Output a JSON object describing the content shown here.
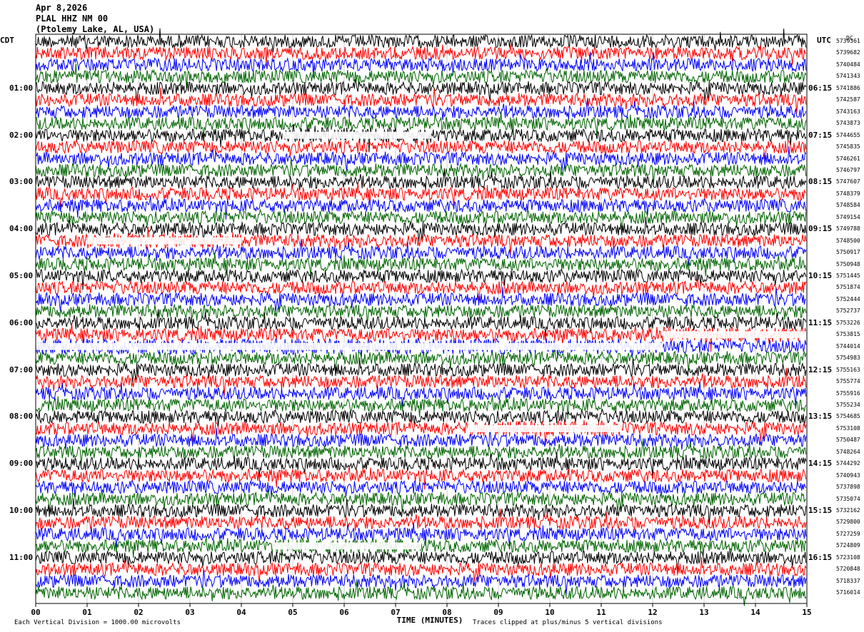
{
  "header": {
    "date": "Apr 8,2026",
    "station": "PLAL HHZ NM 00",
    "location": "(Ptolemy Lake, AL, USA)"
  },
  "left_tz": "CDT",
  "right_tz": "UTC",
  "dc_label": "DC",
  "chart_data": {
    "type": "line",
    "title": "",
    "xlabel": "TIME (MINUTES)",
    "ylabel": "",
    "xlim": [
      0,
      15
    ],
    "x_ticks": [
      "00",
      "01",
      "02",
      "03",
      "04",
      "05",
      "06",
      "07",
      "08",
      "09",
      "10",
      "11",
      "12",
      "13",
      "14",
      "15"
    ],
    "grid": true,
    "trace_colors": [
      "#000000",
      "#ff0000",
      "#0000ff",
      "#006400"
    ],
    "left_hour_labels": [
      "01:00",
      "02:00",
      "03:00",
      "04:00",
      "05:00",
      "06:00",
      "07:00",
      "08:00",
      "09:00",
      "10:00",
      "11:00"
    ],
    "right_hour_labels": [
      "06:15",
      "07:15",
      "08:15",
      "09:15",
      "10:15",
      "11:15",
      "12:15",
      "13:15",
      "14:15",
      "15:15",
      "16:15"
    ],
    "trace_dc_offsets": [
      "5739361",
      "5739682",
      "5740484",
      "5741343",
      "5741886",
      "5742587",
      "5743163",
      "5743873",
      "5744655",
      "5745835",
      "5746261",
      "5746797",
      "5747607",
      "5748379",
      "5748584",
      "5749154",
      "5749788",
      "5748500",
      "5750917",
      "5750948",
      "5751445",
      "5751874",
      "5752444",
      "5752737",
      "5753226",
      "5753815",
      "5744014",
      "5754983",
      "5755163",
      "5755774",
      "5755916",
      "5755234",
      "5754685",
      "5753108",
      "5750487",
      "5748264",
      "5744292",
      "5740943",
      "5737898",
      "5735074",
      "5732162",
      "5729800",
      "5727259",
      "5724809",
      "5723108",
      "5720848",
      "5718337",
      "5716014"
    ],
    "clip_segments": [
      {
        "trace": 8,
        "from_min": 4.8,
        "to_min": 7.7
      },
      {
        "trace": 17,
        "from_min": 1.0,
        "to_min": 4.0
      },
      {
        "trace": 25,
        "from_min": 12.2,
        "to_min": 15.0
      },
      {
        "trace": 26,
        "from_min": 0.0,
        "to_min": 12.2
      },
      {
        "trace": 33,
        "from_min": 8.4,
        "to_min": 11.4
      },
      {
        "trace": 43,
        "from_min": 4.6,
        "to_min": 7.5
      }
    ]
  },
  "footer": {
    "scale_note": "Each Vertical Division = 1000.00 microvolts",
    "clip_note": "Traces clipped at plus/minus 5 vertical divisions"
  }
}
